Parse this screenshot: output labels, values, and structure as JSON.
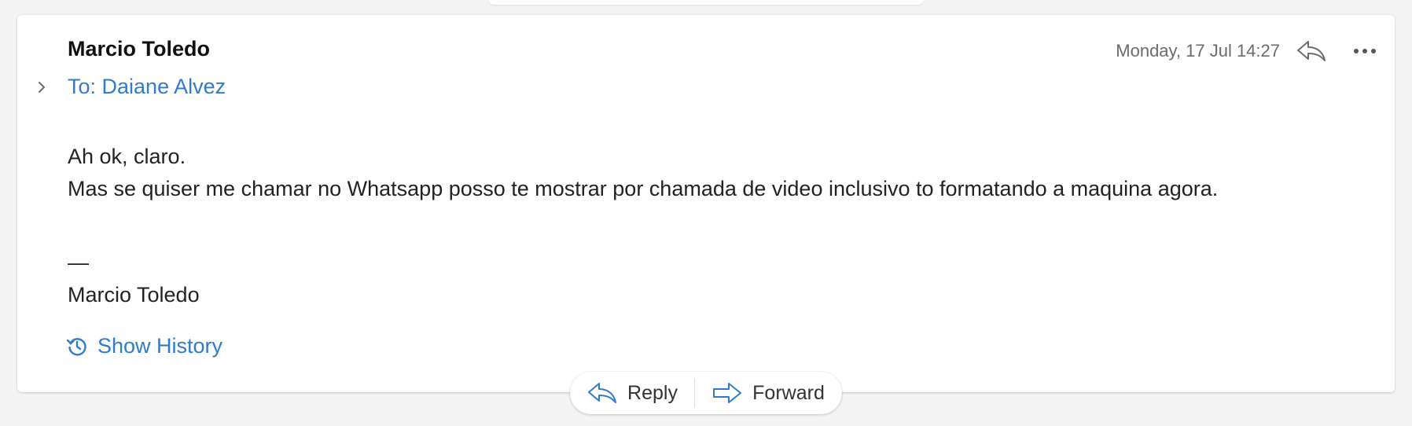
{
  "message": {
    "sender": "Marcio Toledo",
    "recipients": "To: Daiane Alvez",
    "date": "Monday, 17 Jul 14:27",
    "body_lines": [
      "Ah ok, claro.",
      "Mas se quiser me chamar no Whatsapp posso te mostrar por chamada de video inclusivo to formatando a maquina agora."
    ],
    "signature_separator": "—",
    "signature_name": "Marcio Toledo",
    "show_history_label": "Show History"
  },
  "actions": {
    "reply_label": "Reply",
    "forward_label": "Forward"
  },
  "icons": {
    "expand": "chevron-right-icon",
    "reply": "reply-arrow-icon",
    "more": "more-dots-icon",
    "history": "history-clock-icon",
    "forward": "forward-arrow-icon"
  },
  "colors": {
    "accent": "#2f7bd1",
    "background": "#f4f4f4",
    "card": "#ffffff",
    "muted_text": "#6b6b6b"
  }
}
